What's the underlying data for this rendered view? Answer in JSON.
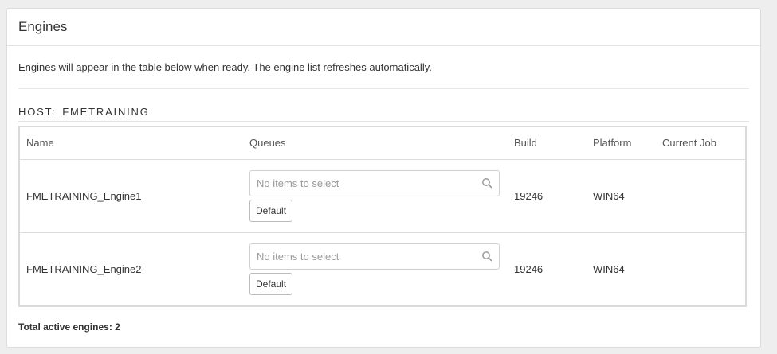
{
  "panel": {
    "title": "Engines",
    "intro": "Engines will appear in the table below when ready. The engine list refreshes automatically."
  },
  "host": {
    "label": "HOST:",
    "name": "FMETRAINING"
  },
  "table": {
    "headers": {
      "name": "Name",
      "queues": "Queues",
      "build": "Build",
      "platform": "Platform",
      "current_job": "Current Job"
    },
    "rows": [
      {
        "name": "FMETRAINING_Engine1",
        "queue_placeholder": "No items to select",
        "queue_tag": "Default",
        "build": "19246",
        "platform": "WIN64",
        "current_job": ""
      },
      {
        "name": "FMETRAINING_Engine2",
        "queue_placeholder": "No items to select",
        "queue_tag": "Default",
        "build": "19246",
        "platform": "WIN64",
        "current_job": ""
      }
    ]
  },
  "footer": {
    "total_label": "Total active engines: 2"
  },
  "icons": {
    "queue_search": "search-icon"
  },
  "colors": {
    "background": "#eeeeee",
    "panel_border": "#dcdcdc",
    "placeholder": "#9a9a9a"
  }
}
